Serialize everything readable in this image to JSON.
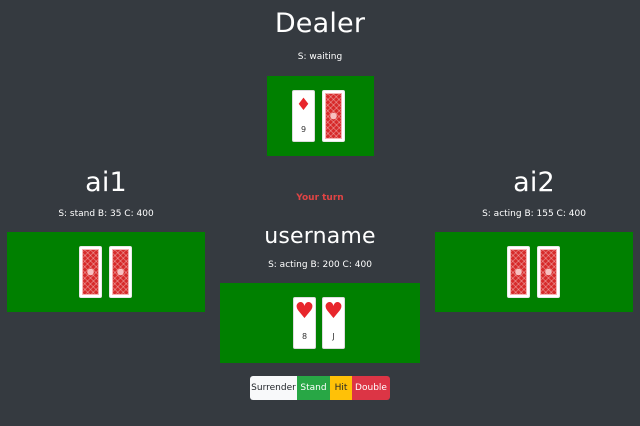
{
  "dealer": {
    "name": "Dealer",
    "status": "S: waiting",
    "cards": [
      {
        "face": "up",
        "suit": "diamond",
        "symbol": "♦",
        "rank": "9",
        "color": "#e8262c"
      },
      {
        "face": "down"
      }
    ]
  },
  "turn_message": "Your turn",
  "ai1": {
    "name": "ai1",
    "status": "S: stand B: 35 C: 400",
    "cards": [
      {
        "face": "down"
      },
      {
        "face": "down"
      }
    ]
  },
  "ai2": {
    "name": "ai2",
    "status": "S: acting B: 155 C: 400",
    "cards": [
      {
        "face": "down"
      },
      {
        "face": "down"
      }
    ]
  },
  "player": {
    "name": "username",
    "status": "S: acting B: 200 C: 400",
    "cards": [
      {
        "face": "up",
        "suit": "heart",
        "symbol": "♥",
        "rank": "8",
        "color": "#e8262c"
      },
      {
        "face": "up",
        "suit": "heart",
        "symbol": "♥",
        "rank": "J",
        "color": "#e8262c"
      }
    ]
  },
  "actions": {
    "surrender": "Surrender",
    "stand": "Stand",
    "hit": "Hit",
    "double": "Double"
  },
  "colors": {
    "background": "#353a40",
    "felt": "#008000",
    "turn_message": "#e14444",
    "card_back": "#d72a2a"
  }
}
